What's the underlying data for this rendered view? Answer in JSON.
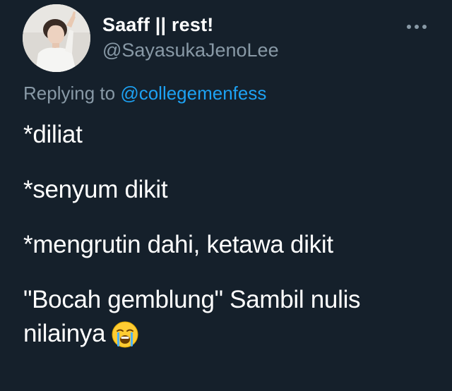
{
  "tweet": {
    "author": {
      "display_name": "Saaff || rest!",
      "handle": "@SayasukaJenoLee",
      "avatar_icon": "profile-photo"
    },
    "more_icon": "more-dots-icon",
    "reply": {
      "prefix": "Replying to",
      "mention": "@collegemenfess"
    },
    "lines": [
      "*diliat",
      "*senyum dikit",
      "*mengrutin dahi, ketawa dikit",
      "\"Bocah gemblung\" Sambil nulis nilainya"
    ],
    "emoji": "loudly-crying-face-icon"
  },
  "colors": {
    "background": "#15202b",
    "text": "#ffffff",
    "muted": "#8899a6",
    "accent": "#1da1f2"
  }
}
